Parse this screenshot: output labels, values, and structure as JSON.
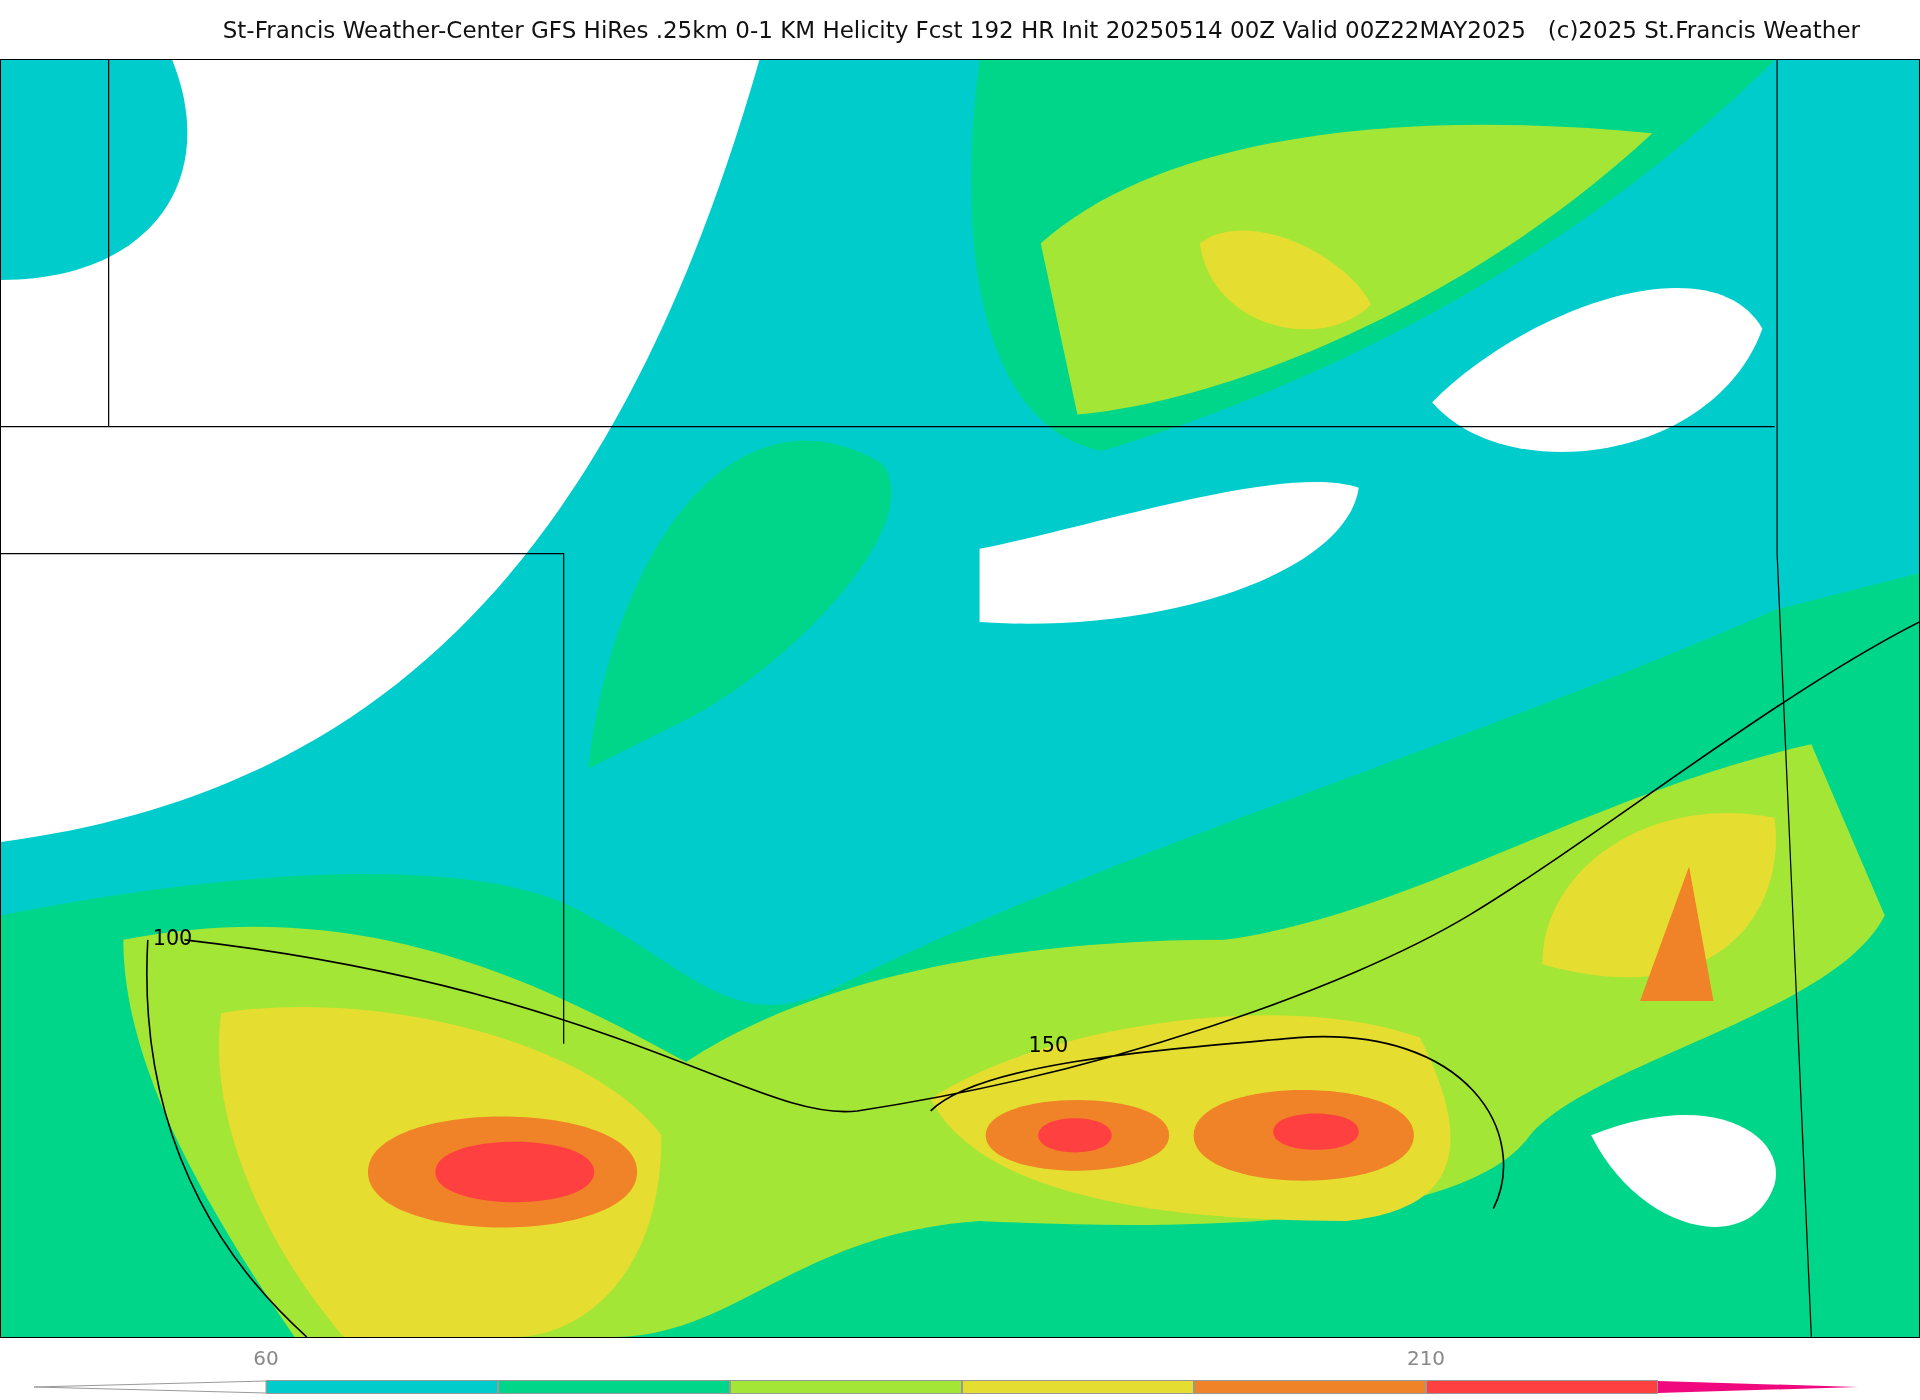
{
  "header": {
    "title": "St-Francis Weather-Center GFS HiRes .25km 0-1 KM Helicity Fcst 192 HR Init 20250514 00Z  Valid 00Z22MAY2025",
    "credit": "(c)2025 St.Francis Weather"
  },
  "map": {
    "contour_labels": [
      "100",
      "150"
    ]
  },
  "colorbar": {
    "segments": [
      {
        "kind": "bar",
        "color": "#00cccc",
        "label": "60"
      },
      {
        "kind": "bar",
        "color": "#00d68a"
      },
      {
        "kind": "bar",
        "color": "#a3e635"
      },
      {
        "kind": "bar",
        "color": "#e5dd30"
      },
      {
        "kind": "bar",
        "color": "#f08228"
      },
      {
        "kind": "bar",
        "color": "#ff4040",
        "label": "210"
      },
      {
        "kind": "arrow",
        "color": "#f0087f"
      }
    ]
  }
}
